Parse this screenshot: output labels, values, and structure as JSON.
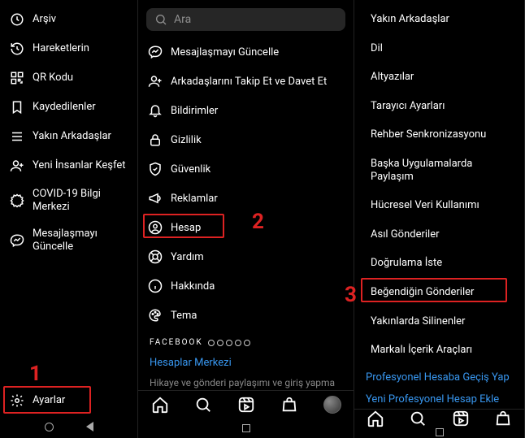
{
  "panel1": {
    "items": [
      {
        "label": "Arşiv",
        "icon": "clock"
      },
      {
        "label": "Hareketlerin",
        "icon": "clock-back"
      },
      {
        "label": "QR Kodu",
        "icon": "qr"
      },
      {
        "label": "Kaydedilenler",
        "icon": "bookmark"
      },
      {
        "label": "Yakın Arkadaşlar",
        "icon": "list"
      },
      {
        "label": "Yeni İnsanlar Keşfet",
        "icon": "person-add"
      },
      {
        "label": "COVID-19 Bilgi Merkezi",
        "icon": "heart-badge"
      },
      {
        "label": "Mesajlaşmayı Güncelle",
        "icon": "messenger"
      }
    ],
    "settings": {
      "label": "Ayarlar",
      "icon": "gear"
    }
  },
  "panel2": {
    "search_placeholder": "Ara",
    "items": [
      {
        "label": "Mesajlaşmayı Güncelle",
        "icon": "messenger"
      },
      {
        "label": "Arkadaşlarını Takip Et ve Davet Et",
        "icon": "person-add"
      },
      {
        "label": "Bildirimler",
        "icon": "bell"
      },
      {
        "label": "Gizlilik",
        "icon": "lock"
      },
      {
        "label": "Güvenlik",
        "icon": "shield"
      },
      {
        "label": "Reklamlar",
        "icon": "megaphone"
      },
      {
        "label": "Hesap",
        "icon": "user-circle"
      },
      {
        "label": "Yardım",
        "icon": "lifebuoy"
      },
      {
        "label": "Hakkında",
        "icon": "info"
      },
      {
        "label": "Tema",
        "icon": "palette"
      }
    ],
    "fb_label": "FACEBOOK",
    "accounts_center": "Hesaplar Merkezi",
    "subtext": "Hikaye ve gönderi paylaşımı ve giriş yapma"
  },
  "panel3": {
    "items": [
      {
        "label": "Yakın Arkadaşlar"
      },
      {
        "label": "Dil"
      },
      {
        "label": "Altyazılar"
      },
      {
        "label": "Tarayıcı Ayarları"
      },
      {
        "label": "Rehber Senkronizasyonu"
      },
      {
        "label": "Başka Uygulamalarda Paylaşım"
      },
      {
        "label": "Hücresel Veri Kullanımı"
      },
      {
        "label": "Asıl Gönderiler"
      },
      {
        "label": "Doğrulama İste"
      },
      {
        "label": "Beğendiğin Gönderiler"
      },
      {
        "label": "Yakınlarda Silinenler"
      },
      {
        "label": "Markalı İçerik Araçları"
      }
    ],
    "link_pro": "Profesyonel Hesaba Geçiş Yap",
    "link_newpro": "Yeni Profesyonel Hesap Ekle"
  },
  "annotations": {
    "num1": "1",
    "num2": "2",
    "num3": "3"
  },
  "colors": {
    "highlight": "#dd2222",
    "link": "#3897f0"
  }
}
